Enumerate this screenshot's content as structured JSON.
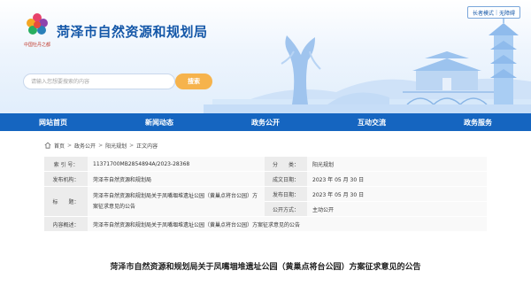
{
  "header": {
    "site_title": "菏泽市自然资源和规划局",
    "access": {
      "elderly": "长者模式",
      "accessible": "无障碍"
    },
    "search": {
      "placeholder": "请输入您想要搜索的内容",
      "button": "搜索"
    }
  },
  "nav": {
    "items": [
      {
        "label": "网站首页"
      },
      {
        "label": "新闻动态"
      },
      {
        "label": "政务公开"
      },
      {
        "label": "互动交流"
      },
      {
        "label": "政务服务"
      }
    ]
  },
  "breadcrumb": {
    "items": [
      "首页",
      "政务公开",
      "阳光规划",
      "正文内容"
    ],
    "separator": ">"
  },
  "info": {
    "index_label": "索 引 号：",
    "index_value": "11371700MB2854894A/2023-28368",
    "category_label": "分　　类：",
    "category_value": "阳光规划",
    "publisher_label": "发布机构：",
    "publisher_value": "菏泽市自然资源和规划局",
    "created_label": "成文日期：",
    "created_value": "2023 年 05 月 30 日",
    "title_label": "标　　题：",
    "title_value": "菏泽市自然资源和规划局关于凤嘴堌堆遗址公园（黄巢点将台公园）方案征求意见的公告",
    "published_label": "发布日期：",
    "published_value": "2023 年 05 月 30 日",
    "public_label": "公开方式：",
    "public_value": "主动公开",
    "summary_label": "内容概述：",
    "summary_value": "菏泽市自然资源和规划局关于凤嘴堌堆遗址公园（黄巢点将台公园）方案征求意见的公告"
  },
  "article": {
    "title": "菏泽市自然资源和规划局关于凤嘴堌堆遗址公园（黄巢点将台公园）方案征求意见的公告"
  },
  "colors": {
    "brand_blue": "#1565c0",
    "title_blue": "#1457a8",
    "search_orange": "#f6b34c"
  }
}
